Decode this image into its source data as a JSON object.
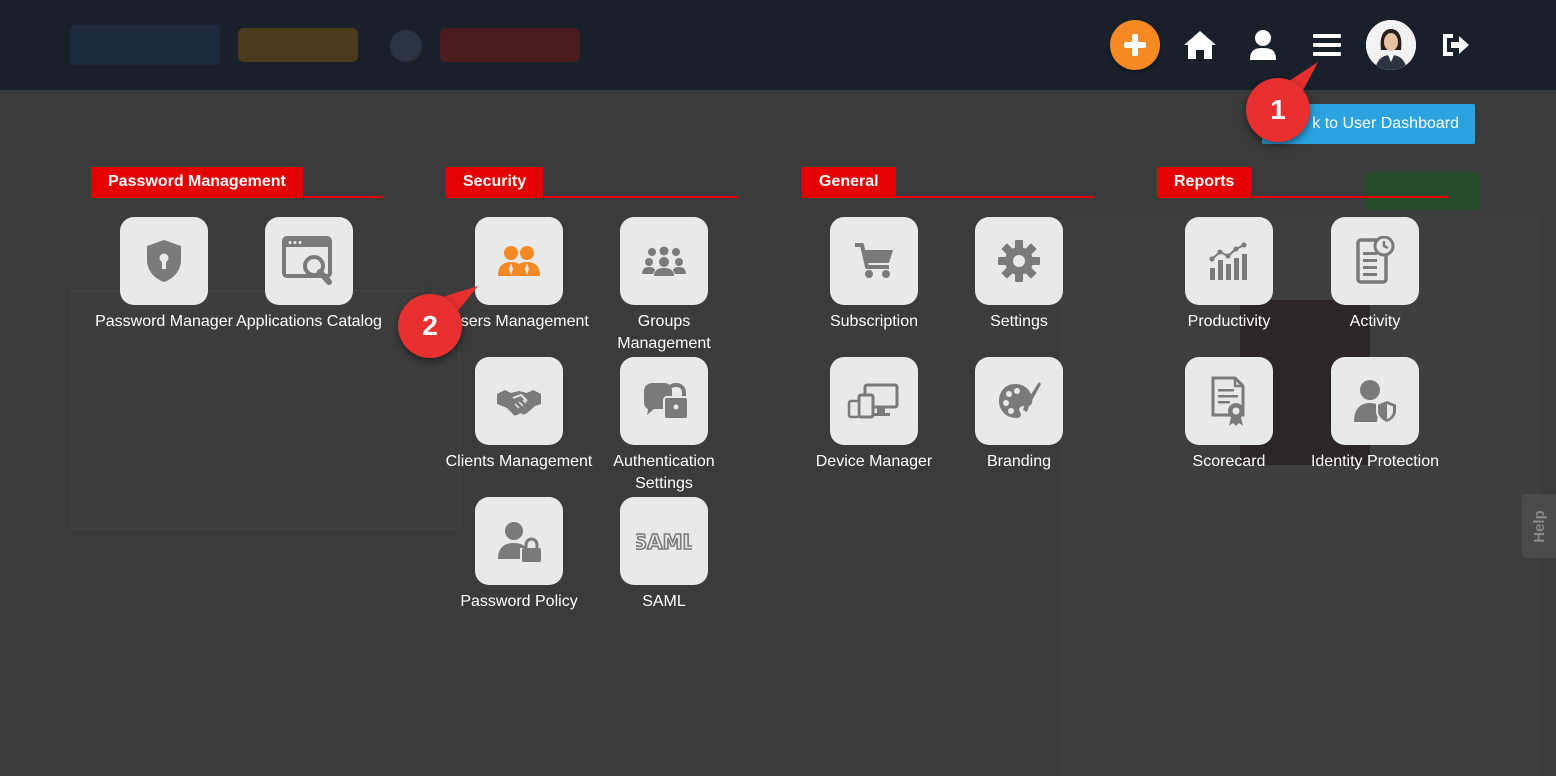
{
  "colors": {
    "overlay_bg": "#3b3b3b",
    "section_accent": "#e20000",
    "tile_bg": "#e8eaea",
    "icon_gray": "#7a7a7a",
    "highlight_icon": "#f58a25",
    "back_button": "#2aa3e0",
    "callout": "#e7302f"
  },
  "topbar": {
    "icons": [
      "plus-icon",
      "home-icon",
      "user-icon",
      "menu-icon",
      "avatar",
      "logout-icon"
    ]
  },
  "back_button_label": "k to User Dashboard",
  "callouts": [
    "1",
    "2"
  ],
  "sections": [
    {
      "title": "Password Management",
      "tiles": [
        {
          "label": "Password Manager",
          "icon": "shield-lock-icon"
        },
        {
          "label": "Applications Catalog",
          "icon": "app-search-icon"
        }
      ]
    },
    {
      "title": "Security",
      "tiles": [
        {
          "label": "Users Management",
          "icon": "users-icon"
        },
        {
          "label": "Groups Management",
          "icon": "groups-icon"
        },
        {
          "label": "Clients Management",
          "icon": "handshake-icon"
        },
        {
          "label": "Authentication Settings",
          "icon": "lock-chat-icon"
        },
        {
          "label": "Password Policy",
          "icon": "user-lock-icon"
        },
        {
          "label": "SAML",
          "icon": "saml-icon"
        }
      ]
    },
    {
      "title": "General",
      "tiles": [
        {
          "label": "Subscription",
          "icon": "cart-icon"
        },
        {
          "label": "Settings",
          "icon": "gear-icon"
        },
        {
          "label": "Device Manager",
          "icon": "devices-icon"
        },
        {
          "label": "Branding",
          "icon": "palette-icon"
        }
      ]
    },
    {
      "title": "Reports",
      "tiles": [
        {
          "label": "Productivity",
          "icon": "bar-chart-icon"
        },
        {
          "label": "Activity",
          "icon": "activity-doc-icon"
        },
        {
          "label": "Scorecard",
          "icon": "certificate-icon"
        },
        {
          "label": "Identity Protection",
          "icon": "identity-shield-icon"
        }
      ]
    }
  ],
  "help_label": "Help"
}
